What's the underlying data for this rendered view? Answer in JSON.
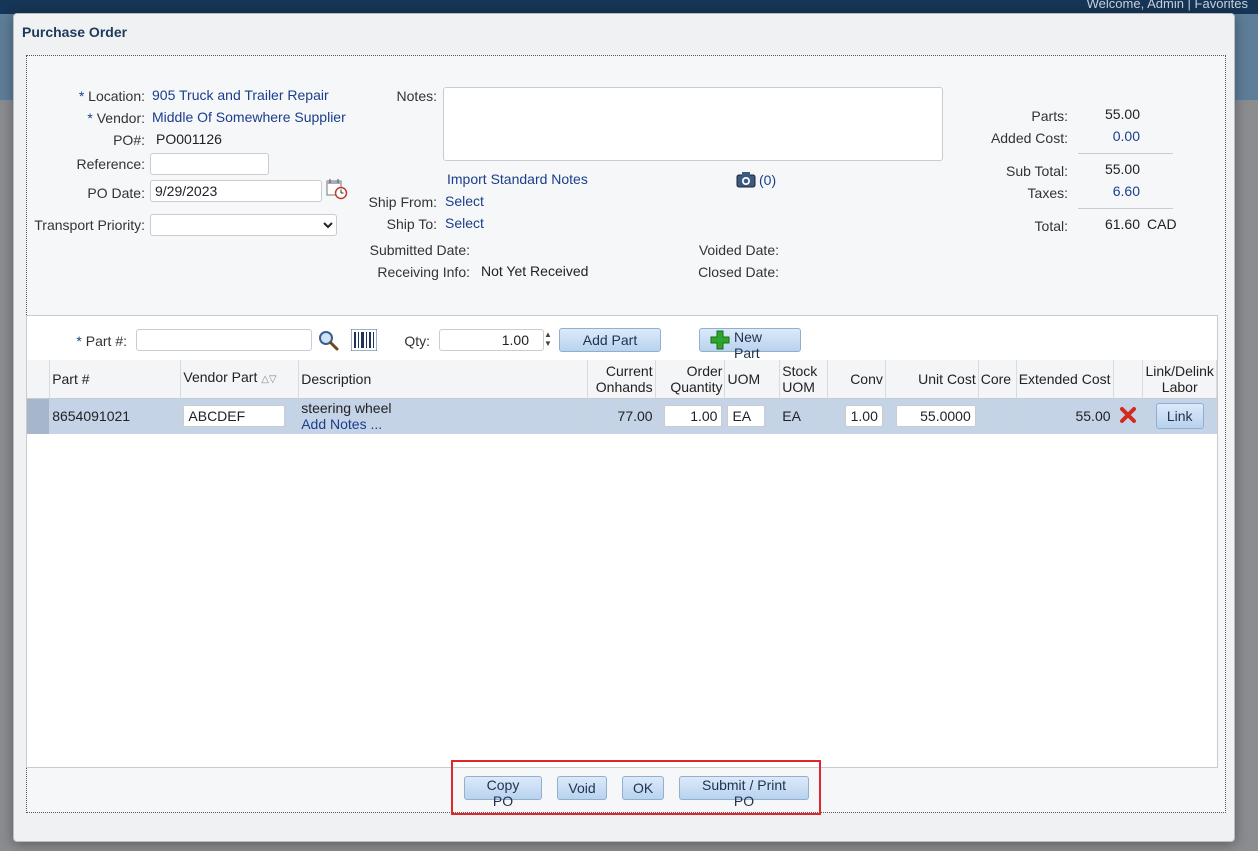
{
  "background": {
    "welcome_text": "Welcome, Admin  |   Favorites"
  },
  "dialog": {
    "title": "Purchase Order"
  },
  "header": {
    "location_label": "Location:",
    "location_value": "905 Truck and Trailer Repair",
    "vendor_label": "Vendor:",
    "vendor_value": "Middle Of Somewhere Supplier",
    "po_label": "PO#:",
    "po_value": "PO001126",
    "reference_label": "Reference:",
    "reference_value": "",
    "po_date_label": "PO Date:",
    "po_date_value": "9/29/2023",
    "transport_label": "Transport Priority:",
    "transport_value": "",
    "notes_label": "Notes:",
    "notes_value": "",
    "import_notes_link": "Import Standard Notes",
    "attachments_count": "(0)",
    "ship_from_label": "Ship From:",
    "ship_from_value": "Select",
    "ship_to_label": "Ship To:",
    "ship_to_value": "Select",
    "submitted_label": "Submitted Date:",
    "voided_label": "Voided Date:",
    "receiving_label": "Receiving Info:",
    "receiving_value": "Not Yet Received",
    "closed_label": "Closed Date:"
  },
  "summary": {
    "parts_label": "Parts:",
    "parts_value": "55.00",
    "added_cost_label": "Added Cost:",
    "added_cost_value": "0.00",
    "subtotal_label": "Sub Total:",
    "subtotal_value": "55.00",
    "taxes_label": "Taxes:",
    "taxes_value": "6.60",
    "total_label": "Total:",
    "total_value": "61.60",
    "currency": "CAD"
  },
  "part_entry": {
    "part_label": "Part #:",
    "part_value": "",
    "qty_label": "Qty:",
    "qty_value": "1.00",
    "add_part": "Add Part",
    "new_part": "New Part"
  },
  "grid": {
    "columns": {
      "part": "Part #",
      "vendor_part": "Vendor Part",
      "description": "Description",
      "current_onhands_1": "Current",
      "current_onhands_2": "Onhands",
      "order_qty_1": "Order",
      "order_qty_2": "Quantity",
      "uom": "UOM",
      "stock_uom_1": "Stock",
      "stock_uom_2": "UOM",
      "conv": "Conv",
      "unit_cost": "Unit Cost",
      "core": "Core",
      "extended_cost": "Extended Cost",
      "link_1": "Link/Delink",
      "link_2": "Labor"
    },
    "rows": [
      {
        "part": "8654091021",
        "vendor_part": "ABCDEF",
        "description": "steering wheel",
        "add_notes": "Add Notes ...",
        "current_onhands": "77.00",
        "order_qty": "1.00",
        "uom": "EA",
        "stock_uom": "EA",
        "conv": "1.00",
        "unit_cost": "55.0000",
        "core": "",
        "extended_cost": "55.00",
        "link": "Link"
      }
    ]
  },
  "footer": {
    "copy_po": "Copy PO",
    "void": "Void",
    "ok": "OK",
    "submit_print": "Submit / Print PO"
  },
  "colors": {
    "link_blue": "#1a3e8c",
    "highlight_red": "#e0262a",
    "selected_row": "#c4d3e6"
  }
}
